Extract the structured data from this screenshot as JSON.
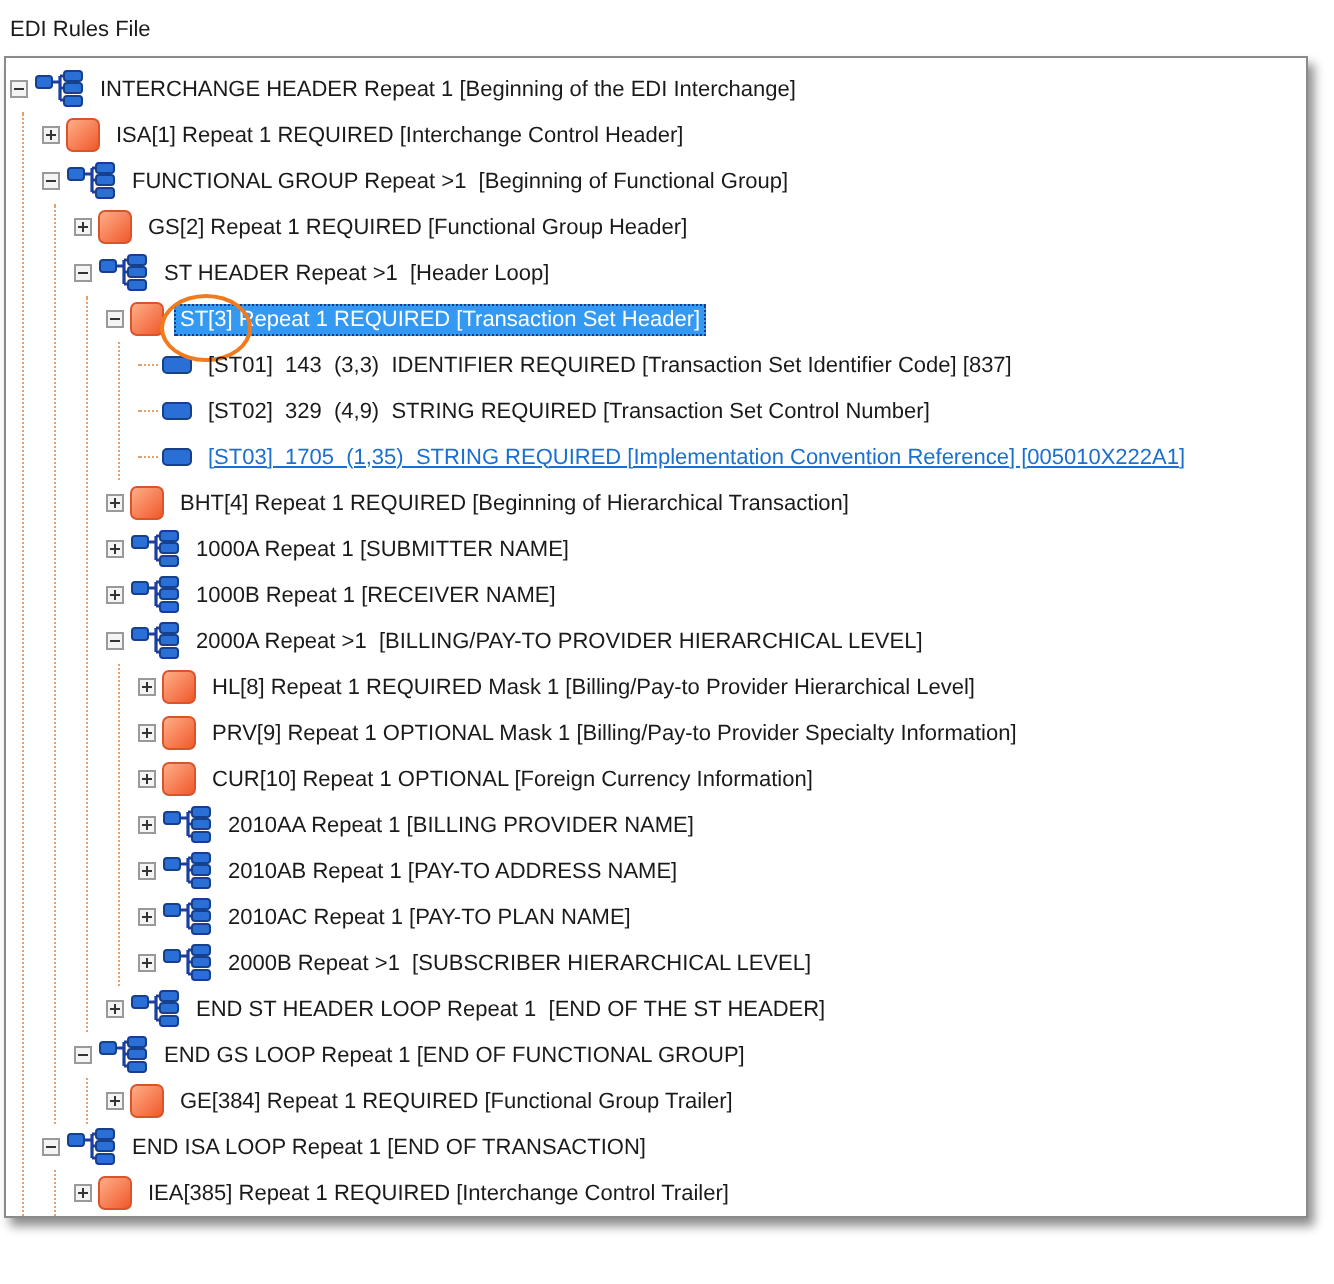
{
  "title": "EDI Rules File",
  "tree": [
    {
      "kind": "loop",
      "label": "INTERCHANGE HEADER Repeat 1 [Beginning of the EDI Interchange]",
      "expanded": true,
      "selected": false,
      "hot": false,
      "circled": false,
      "children": [
        {
          "kind": "segment",
          "label": "ISA[1] Repeat 1 REQUIRED [Interchange Control Header]",
          "expanded": false,
          "selected": false,
          "hot": false,
          "circled": false
        },
        {
          "kind": "loop",
          "label": "FUNCTIONAL GROUP Repeat >1  [Beginning of Functional Group]",
          "expanded": true,
          "selected": false,
          "hot": false,
          "circled": false,
          "children": [
            {
              "kind": "segment",
              "label": "GS[2] Repeat 1 REQUIRED [Functional Group Header]",
              "expanded": false,
              "selected": false,
              "hot": false,
              "circled": false
            },
            {
              "kind": "loop",
              "label": "ST HEADER Repeat >1  [Header Loop]",
              "expanded": true,
              "selected": false,
              "hot": false,
              "circled": false,
              "children": [
                {
                  "kind": "segment",
                  "label": "ST[3] Repeat 1 REQUIRED [Transaction Set Header]",
                  "expanded": true,
                  "selected": true,
                  "hot": false,
                  "circled": true,
                  "children": [
                    {
                      "kind": "element",
                      "label": "[ST01]  143  (3,3)  IDENTIFIER REQUIRED [Transaction Set Identifier Code] [837]",
                      "selected": false,
                      "hot": false,
                      "circled": false
                    },
                    {
                      "kind": "element",
                      "label": "[ST02]  329  (4,9)  STRING REQUIRED [Transaction Set Control Number]",
                      "selected": false,
                      "hot": false,
                      "circled": false
                    },
                    {
                      "kind": "element",
                      "label": "[ST03]  1705  (1,35)  STRING REQUIRED [Implementation Convention Reference] [005010X222A1]",
                      "selected": false,
                      "hot": true,
                      "circled": false
                    }
                  ]
                },
                {
                  "kind": "segment",
                  "label": "BHT[4] Repeat 1 REQUIRED [Beginning of Hierarchical Transaction]",
                  "expanded": false,
                  "selected": false,
                  "hot": false,
                  "circled": false
                },
                {
                  "kind": "loop",
                  "label": "1000A Repeat 1 [SUBMITTER NAME]",
                  "expanded": false,
                  "selected": false,
                  "hot": false,
                  "circled": false
                },
                {
                  "kind": "loop",
                  "label": "1000B Repeat 1 [RECEIVER NAME]",
                  "expanded": false,
                  "selected": false,
                  "hot": false,
                  "circled": false
                },
                {
                  "kind": "loop",
                  "label": "2000A Repeat >1  [BILLING/PAY-TO PROVIDER HIERARCHICAL LEVEL]",
                  "expanded": true,
                  "selected": false,
                  "hot": false,
                  "circled": false,
                  "children": [
                    {
                      "kind": "segment",
                      "label": "HL[8] Repeat 1 REQUIRED Mask 1 [Billing/Pay-to Provider Hierarchical Level]",
                      "expanded": false,
                      "selected": false,
                      "hot": false,
                      "circled": false
                    },
                    {
                      "kind": "segment",
                      "label": "PRV[9] Repeat 1 OPTIONAL Mask 1 [Billing/Pay-to Provider Specialty Information]",
                      "expanded": false,
                      "selected": false,
                      "hot": false,
                      "circled": false
                    },
                    {
                      "kind": "segment",
                      "label": "CUR[10] Repeat 1 OPTIONAL [Foreign Currency Information]",
                      "expanded": false,
                      "selected": false,
                      "hot": false,
                      "circled": false
                    },
                    {
                      "kind": "loop",
                      "label": "2010AA Repeat 1 [BILLING PROVIDER NAME]",
                      "expanded": false,
                      "selected": false,
                      "hot": false,
                      "circled": false
                    },
                    {
                      "kind": "loop",
                      "label": "2010AB Repeat 1 [PAY-TO ADDRESS NAME]",
                      "expanded": false,
                      "selected": false,
                      "hot": false,
                      "circled": false
                    },
                    {
                      "kind": "loop",
                      "label": "2010AC Repeat 1 [PAY-TO PLAN NAME]",
                      "expanded": false,
                      "selected": false,
                      "hot": false,
                      "circled": false
                    },
                    {
                      "kind": "loop",
                      "label": "2000B Repeat >1  [SUBSCRIBER HIERARCHICAL LEVEL]",
                      "expanded": false,
                      "selected": false,
                      "hot": false,
                      "circled": false
                    }
                  ]
                },
                {
                  "kind": "loop",
                  "label": "END ST HEADER LOOP Repeat 1  [END OF THE ST HEADER]",
                  "expanded": false,
                  "selected": false,
                  "hot": false,
                  "circled": false
                }
              ]
            },
            {
              "kind": "loop",
              "label": "END GS LOOP Repeat 1 [END OF FUNCTIONAL GROUP]",
              "expanded": true,
              "selected": false,
              "hot": false,
              "circled": false,
              "children": [
                {
                  "kind": "segment",
                  "label": "GE[384] Repeat 1 REQUIRED [Functional Group Trailer]",
                  "expanded": false,
                  "selected": false,
                  "hot": false,
                  "circled": false
                }
              ]
            }
          ]
        },
        {
          "kind": "loop",
          "label": "END ISA LOOP Repeat 1 [END OF TRANSACTION]",
          "expanded": true,
          "selected": false,
          "hot": false,
          "circled": false,
          "children": [
            {
              "kind": "segment",
              "label": "IEA[385] Repeat 1 REQUIRED [Interchange Control Trailer]",
              "expanded": false,
              "selected": false,
              "hot": false,
              "circled": false
            }
          ]
        }
      ]
    }
  ]
}
